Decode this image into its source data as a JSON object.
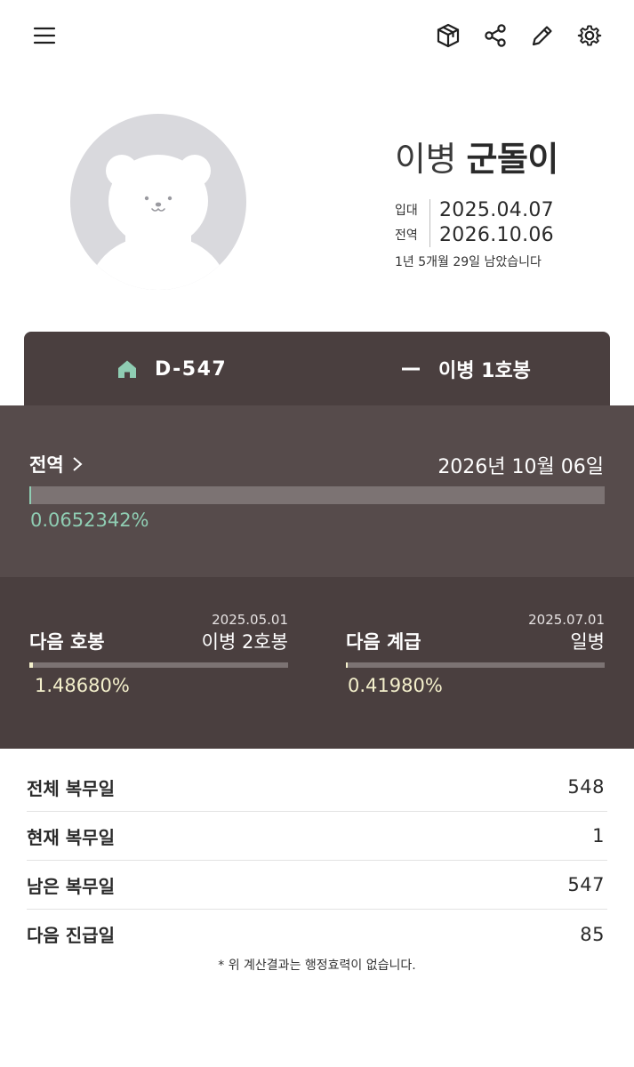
{
  "header": {
    "icons": [
      "menu-icon",
      "box-icon",
      "share-icon",
      "pencil-icon",
      "gear-icon"
    ]
  },
  "profile": {
    "rank": "이병",
    "name": "군돌이",
    "enlist_label": "입대",
    "enlist_date": "2025.04.07",
    "discharge_label": "전역",
    "discharge_date": "2026.10.06",
    "remaining_text": "1년 5개월 29일 남았습니다",
    "avatar_icon": "bear-avatar-icon"
  },
  "tabs": {
    "dday_label": "D-547",
    "dday_icon": "home-icon",
    "pay_label": "이병 1호봉",
    "pay_icon": "dash-icon"
  },
  "discharge": {
    "title": "전역",
    "date_text": "2026년 10월 06일",
    "progress": 0.000652342,
    "percent_text": "0.0652342%"
  },
  "next": {
    "pay": {
      "title": "다음 호봉",
      "date": "2025.05.01",
      "target": "이병 2호봉",
      "progress": 0.014868,
      "percent_text": "1.48680%"
    },
    "rank": {
      "title": "다음 계급",
      "date": "2025.07.01",
      "target": "일병",
      "progress": 0.004198,
      "percent_text": "0.41980%"
    }
  },
  "stats": [
    {
      "label": "전체 복무일",
      "value": "548"
    },
    {
      "label": "현재 복무일",
      "value": "1"
    },
    {
      "label": "남은 복무일",
      "value": "547"
    },
    {
      "label": "다음 진급일",
      "value": "85"
    }
  ],
  "disclaimer": "* 위 계산결과는 행정효력이 없습니다.",
  "colors": {
    "panel_dark": "#4a3f3f",
    "panel_mid": "#564b4b",
    "accent_green": "#8fcdb3",
    "accent_cream": "#f4f0cc"
  }
}
